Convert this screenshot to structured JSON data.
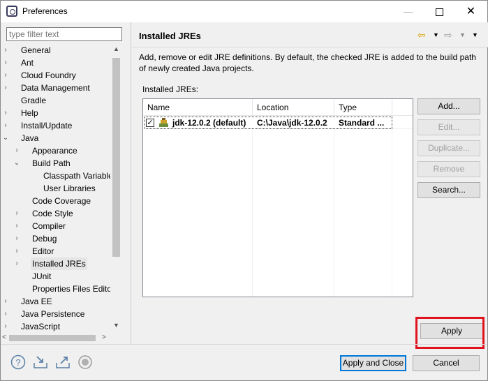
{
  "window": {
    "title": "Preferences"
  },
  "filter": {
    "placeholder": "type filter text"
  },
  "tree": [
    {
      "label": "General",
      "level": 0,
      "expander": "collapsed"
    },
    {
      "label": "Ant",
      "level": 0,
      "expander": "collapsed"
    },
    {
      "label": "Cloud Foundry",
      "level": 0,
      "expander": "collapsed"
    },
    {
      "label": "Data Management",
      "level": 0,
      "expander": "collapsed"
    },
    {
      "label": "Gradle",
      "level": 0,
      "expander": "none"
    },
    {
      "label": "Help",
      "level": 0,
      "expander": "collapsed"
    },
    {
      "label": "Install/Update",
      "level": 0,
      "expander": "collapsed"
    },
    {
      "label": "Java",
      "level": 0,
      "expander": "expanded"
    },
    {
      "label": "Appearance",
      "level": 1,
      "expander": "collapsed"
    },
    {
      "label": "Build Path",
      "level": 1,
      "expander": "expanded"
    },
    {
      "label": "Classpath Variable",
      "level": 2,
      "expander": "none"
    },
    {
      "label": "User Libraries",
      "level": 2,
      "expander": "none"
    },
    {
      "label": "Code Coverage",
      "level": 1,
      "expander": "none"
    },
    {
      "label": "Code Style",
      "level": 1,
      "expander": "collapsed"
    },
    {
      "label": "Compiler",
      "level": 1,
      "expander": "collapsed"
    },
    {
      "label": "Debug",
      "level": 1,
      "expander": "collapsed"
    },
    {
      "label": "Editor",
      "level": 1,
      "expander": "collapsed"
    },
    {
      "label": "Installed JREs",
      "level": 1,
      "expander": "collapsed",
      "selected": true
    },
    {
      "label": "JUnit",
      "level": 1,
      "expander": "none"
    },
    {
      "label": "Properties Files Editor",
      "level": 1,
      "expander": "none"
    },
    {
      "label": "Java EE",
      "level": 0,
      "expander": "collapsed"
    },
    {
      "label": "Java Persistence",
      "level": 0,
      "expander": "collapsed"
    },
    {
      "label": "JavaScript",
      "level": 0,
      "expander": "collapsed"
    }
  ],
  "page": {
    "title": "Installed JREs",
    "description": "Add, remove or edit JRE definitions. By default, the checked JRE is added to the build path of newly created Java projects.",
    "table_label": "Installed JREs:",
    "columns": [
      "Name",
      "Location",
      "Type"
    ],
    "rows": [
      {
        "checked": true,
        "name": "jdk-12.0.2 (default)",
        "location": "C:\\Java\\jdk-12.0.2",
        "type": "Standard ..."
      }
    ]
  },
  "buttons": {
    "add": "Add...",
    "edit": "Edit...",
    "duplicate": "Duplicate...",
    "remove": "Remove",
    "search": "Search...",
    "apply": "Apply",
    "apply_close": "Apply and Close",
    "cancel": "Cancel"
  },
  "colors": {
    "highlight_box": "#e0141e",
    "default_button_border": "#0078d7"
  }
}
